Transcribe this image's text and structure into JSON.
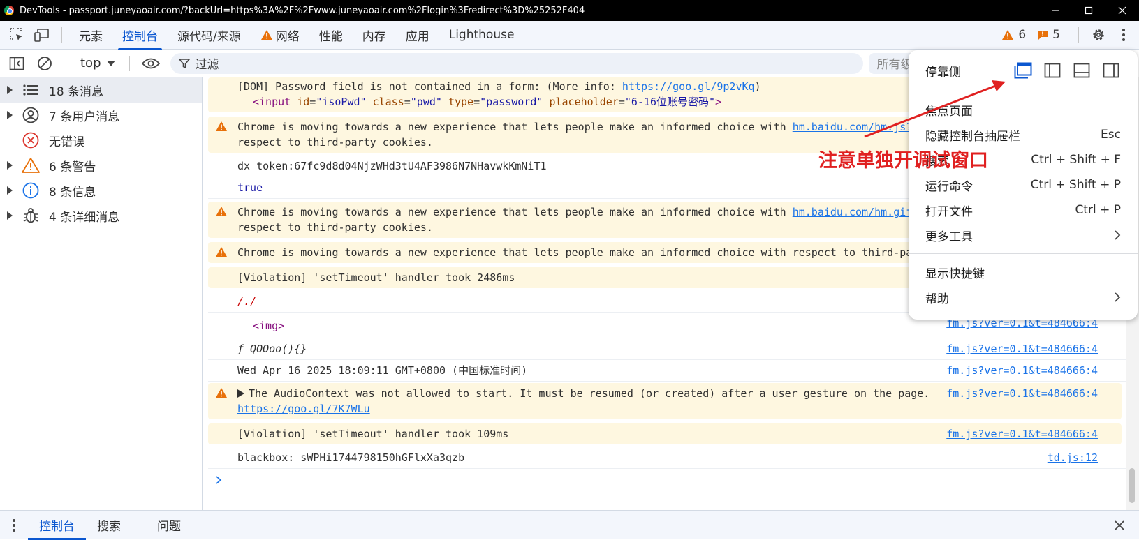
{
  "window": {
    "title": "DevTools - passport.juneyaoair.com/?backUrl=https%3A%2F%2Fwww.juneyaoair.com%2Flogin%3Fredirect%3D%25252F404"
  },
  "tabs": [
    {
      "label": "元素"
    },
    {
      "label": "控制台",
      "active": true
    },
    {
      "label": "源代码/来源"
    },
    {
      "label": "网络",
      "warning": true
    },
    {
      "label": "性能"
    },
    {
      "label": "内存"
    },
    {
      "label": "应用"
    },
    {
      "label": "Lighthouse"
    }
  ],
  "badges": {
    "warnings": "6",
    "issues": "5"
  },
  "toolbar": {
    "context": "top",
    "filter_placeholder": "过滤",
    "levels": "所有级别"
  },
  "sidebar": {
    "items": [
      {
        "label": "18 条消息",
        "icon": "list-icon"
      },
      {
        "label": "7 条用户消息",
        "icon": "user-icon"
      },
      {
        "label": "无错误",
        "icon": "error-icon"
      },
      {
        "label": "6 条警告",
        "icon": "warning-icon"
      },
      {
        "label": "8 条信息",
        "icon": "info-icon"
      },
      {
        "label": "4 条详细消息",
        "icon": "bug-icon"
      }
    ]
  },
  "console": {
    "dom_warning": {
      "text": "[DOM] Password field is not contained in a form: (More info: ",
      "link": "https://goo.gl/9p2vKq",
      "close": ")",
      "html_tag": "input",
      "attrs": [
        {
          "name": "id",
          "value": "\"isoPwd\""
        },
        {
          "name": "class",
          "value": "\"pwd\""
        },
        {
          "name": "type",
          "value": "\"password\""
        },
        {
          "name": "placeholder",
          "value": "\"6-16位账号密码\""
        }
      ]
    },
    "cookie_warning_1": {
      "line1": "Chrome is moving towards a new experience that lets people make an informed choice with ",
      "link": "hm.baidu.com/hm.js?",
      "line2": "respect to third-party cookies."
    },
    "dx_token": "dx_token:67fc9d8d04NjzWHd3tU4AF3986N7NHavwkKmNiT1",
    "true_value": "true",
    "cookie_warning_2": {
      "line1": "Chrome is moving towards a new experience that lets people make an informed choice with ",
      "link": "hm.baidu.com/hm.gif",
      "line2": "respect to third-party cookies."
    },
    "cookie_warning_3": "Chrome is moving towards a new experience that lets people make an informed choice with respect to third-par",
    "violation_1": "[Violation] 'setTimeout' handler took 2486ms",
    "path_value": "/./",
    "img_tag": "<img>",
    "img_src": "fm.js?ver=0.1&t=484666:4",
    "func_value": "ƒ QOOoo(){}",
    "func_src": "fm.js?ver=0.1&t=484666:4",
    "date_value": "Wed Apr 16 2025 18:09:11 GMT+0800 (中国标准时间)",
    "date_src": "fm.js?ver=0.1&t=484666:4",
    "audio_warning": {
      "text": "The AudioContext was not allowed to start. It must be resumed (or created) after a user gesture on the page.",
      "link": "https://goo.gl/7K7WLu",
      "src": "fm.js?ver=0.1&t=484666:4"
    },
    "violation_2": "[Violation] 'setTimeout' handler took 109ms",
    "violation_2_src": "fm.js?ver=0.1&t=484666:4",
    "blackbox": "blackbox:  sWPHi1744798150hGFlxXa3qzb",
    "blackbox_src": "td.js:12"
  },
  "drawer": {
    "tabs": [
      {
        "label": "控制台",
        "active": true
      },
      {
        "label": "搜索"
      },
      {
        "label": "问题"
      }
    ]
  },
  "menu": {
    "dock_label": "停靠侧",
    "items": [
      {
        "label": "焦点页面",
        "shortcut": ""
      },
      {
        "label": "隐藏控制台抽屉栏",
        "shortcut": "Esc"
      },
      {
        "label": "搜索",
        "shortcut": "Ctrl + Shift + F"
      },
      {
        "label": "运行命令",
        "shortcut": "Ctrl + Shift + P"
      },
      {
        "label": "打开文件",
        "shortcut": "Ctrl + P"
      },
      {
        "label": "更多工具",
        "submenu": true
      }
    ],
    "items2": [
      {
        "label": "显示快捷键"
      },
      {
        "label": "帮助",
        "submenu": true
      }
    ]
  },
  "annotation": {
    "text": "注意单独开调试窗口",
    "color": "#e02020"
  },
  "colors": {
    "accent": "#0b57d0",
    "warning_bg": "#fef7e0",
    "link": "#1a73e8"
  }
}
